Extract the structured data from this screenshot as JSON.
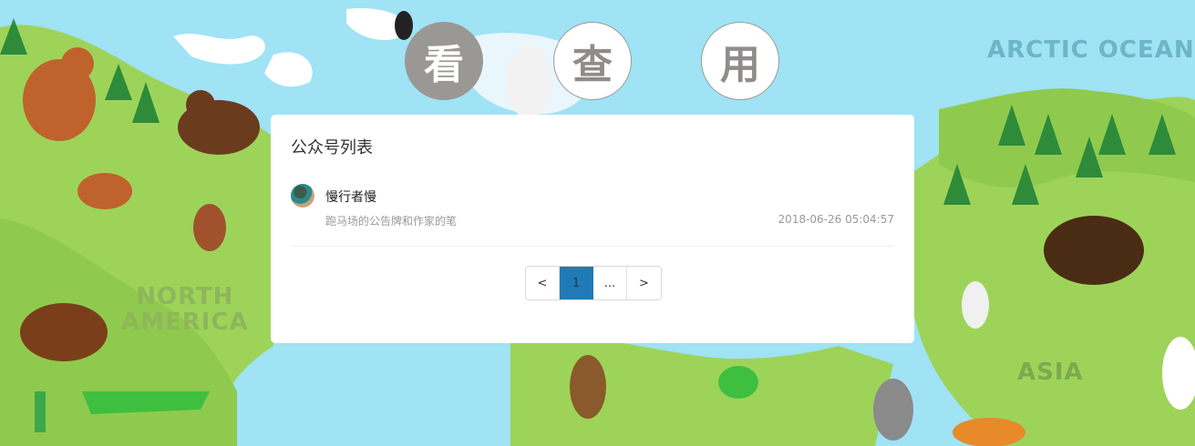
{
  "background": {
    "labels": {
      "arctic": "ARCTIC OCEAN",
      "north_america_line1": "NORTH",
      "north_america_line2": "AMERICA",
      "asia": "ASIA"
    },
    "colors": {
      "ocean": "#9fe3f5",
      "land": "#9ed35a",
      "ice": "#ffffff"
    }
  },
  "nav": [
    {
      "label": "看",
      "state": "active"
    },
    {
      "label": "查",
      "state": "inactive"
    },
    {
      "label": "用",
      "state": "inactive"
    }
  ],
  "card": {
    "title": "公众号列表",
    "items": [
      {
        "name": "慢行者慢",
        "description": "跑马场的公告牌和作家的笔",
        "time": "2018-06-26 05:04:57",
        "avatar_icon": "avatar-icon"
      }
    ]
  },
  "pagination": {
    "prev": "<",
    "pages": [
      "1"
    ],
    "ellipsis": "...",
    "next": ">",
    "current": "1",
    "active_color": "#1f7ab5"
  }
}
